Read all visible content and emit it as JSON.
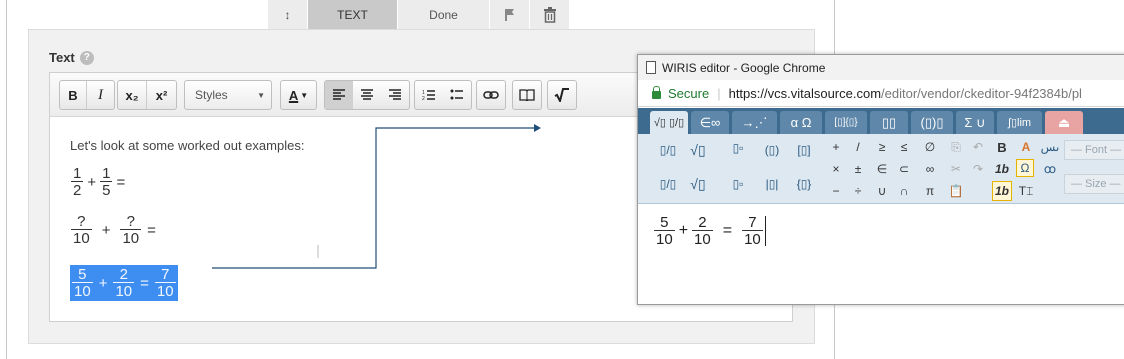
{
  "top_toolbar": {
    "buttons": [
      {
        "name": "move-handle",
        "label": "↕",
        "active": false
      },
      {
        "name": "text-type",
        "label": "TEXT",
        "active": true
      },
      {
        "name": "done",
        "label": "Done",
        "active": false
      },
      {
        "name": "flag",
        "label": "⚑",
        "active": false
      },
      {
        "name": "delete",
        "label": "🗑",
        "active": false
      }
    ]
  },
  "text_field": {
    "label": "Text",
    "help_icon": "?"
  },
  "editor_toolbar": {
    "bold": "B",
    "italic": "I",
    "subscript": "x₂",
    "superscript": "x²",
    "styles_placeholder": "Styles",
    "text_color": "A",
    "align_left": "≡",
    "align_center": "≡",
    "align_right": "≡",
    "numbered_list": "1≡",
    "bulleted_list": "•≡",
    "link": "⚭",
    "book": "📖",
    "sqrt": "√"
  },
  "editor_content": {
    "intro_text": "Let's look at some worked out examples:",
    "rows": [
      {
        "terms": [
          {
            "n": "1",
            "d": "2"
          },
          {
            "n": "1",
            "d": "5"
          }
        ],
        "op": "+",
        "eq": "=",
        "result": null
      },
      {
        "terms": [
          {
            "n": "?",
            "d": "10"
          },
          {
            "n": "?",
            "d": "10"
          }
        ],
        "op": "+",
        "eq": "=",
        "result": null
      },
      {
        "terms": [
          {
            "n": "5",
            "d": "10"
          },
          {
            "n": "2",
            "d": "10"
          }
        ],
        "op": "+",
        "eq": "=",
        "result": {
          "n": "7",
          "d": "10"
        }
      }
    ]
  },
  "popup": {
    "title": "WIRIS editor - Google Chrome",
    "secure_label": "Secure",
    "url_host": "https://vcs.vitalsource.com",
    "url_path": "/editor/vendor/ckeditor-94f2384b/pl",
    "tabs": [
      "√▯ ▯/▯",
      "∈∞",
      "→⋰",
      "α Ω",
      "[▯]{▯}",
      "▯▯",
      "(▯)▯",
      "Σ ∪",
      "∫▯lim",
      "⏏"
    ],
    "font_dropdown": "— Font —",
    "size_dropdown": "— Size —",
    "palette_symbols": [
      "+",
      "/",
      "≥",
      "≤",
      "∅",
      "×",
      "±",
      "∈",
      "⊂",
      "∞",
      "−",
      "÷",
      "∪",
      "∩",
      "π"
    ],
    "formula": {
      "a": {
        "n": "5",
        "d": "10"
      },
      "b": {
        "n": "2",
        "d": "10"
      },
      "c": {
        "n": "7",
        "d": "10"
      },
      "op": "+",
      "eq": "="
    }
  },
  "colors": {
    "highlight": "#3e8ef2",
    "wiris_tab_bar": "#3d6a8f",
    "secure_green": "#1e7a2e"
  }
}
